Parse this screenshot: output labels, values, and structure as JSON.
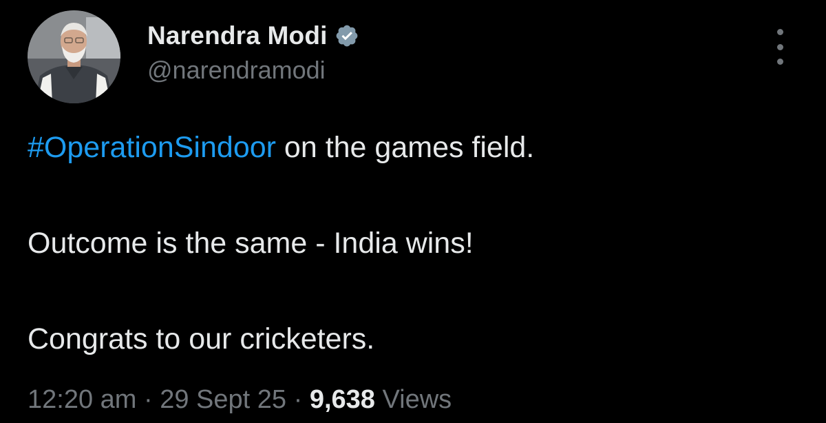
{
  "tweet": {
    "author": {
      "display_name": "Narendra Modi",
      "handle": "@narendramodi",
      "verified_icon": "verified-badge-icon",
      "avatar": "profile-photo"
    },
    "more_icon": "more-options-icon",
    "body": {
      "line1_hashtag": "#OperationSindoor",
      "line1_rest": " on the games field.",
      "line2": "Outcome is the same - India wins!",
      "line3": "Congrats to our cricketers."
    },
    "meta": {
      "time": "12:20 am",
      "separator": " · ",
      "date": "29 Sept 25",
      "views_count": "9,638",
      "views_label": " Views"
    }
  },
  "colors": {
    "background": "#000000",
    "primary_text": "#e7e9ea",
    "secondary_text": "#71767b",
    "link": "#1d9bf0",
    "verified": "#829aab"
  }
}
